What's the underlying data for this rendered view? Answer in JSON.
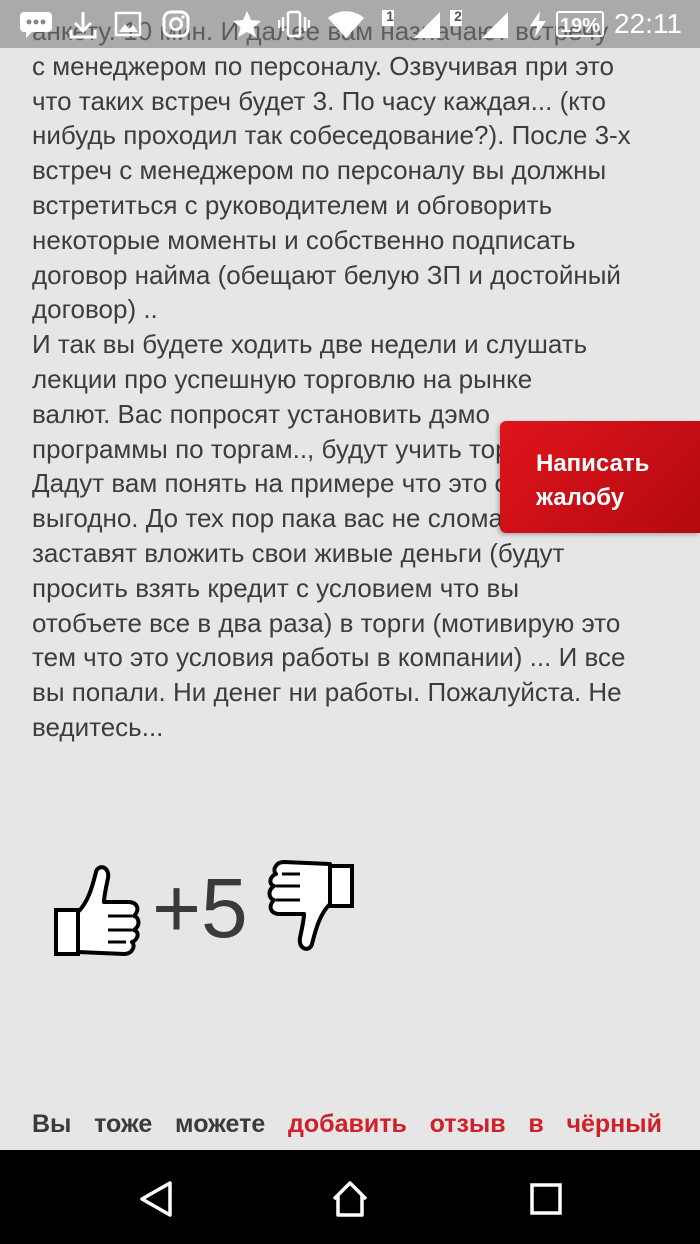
{
  "status_bar": {
    "time": "22:11",
    "battery": "19%",
    "sim1": "1",
    "sim2": "2",
    "icons": [
      "message-icon",
      "download-icon",
      "image-icon",
      "instagram-icon",
      "star-icon",
      "vibrate-icon",
      "wifi-icon",
      "signal-1-icon",
      "signal-2-icon",
      "charging-icon",
      "battery-icon"
    ]
  },
  "review": {
    "text": "анкету. 10 мин. И далее вам назначают встречу\nс менеджером по персоналу. Озвучивая при это\nчто таких встреч будет 3. По часу каждая... (кто\nнибудь проходил так собеседование?). После 3-х\nвстреч с менеджером по персоналу вы должны\nвстретиться с руководителем и обговорить\nнекоторые моменты и собственно подписать\nдоговор найма (обещают белую ЗП и достойный\nдоговор) ..\nИ так вы будете ходить две недели и слушать\nлекции про успешную торговлю на рынке\nвалют. Вас попросят установить дэмо\nпрограммы по торгам.., будут учить торговать.\nДадут вам понять на примере что это очень\nвыгодно. До тех пор пака вас не сломают и не\nзаставят вложить свои живые деньги (будут\nпросить взять кредит с условием что вы\nотобъете все в два раза) в торги (мотивирую это\nтем что это условия работы в компании) ... И все\nвы попали. Ни денег ни работы. Пожалуйста. Не\nведитесь..."
  },
  "votes": {
    "score": "+5"
  },
  "complaint_button": {
    "line1": "Написать",
    "line2": "жалобу"
  },
  "footer": {
    "w1": "Вы",
    "w2": "тоже",
    "w3": "можете",
    "link1": "добавить",
    "link2": "отзыв",
    "link3": "в",
    "link4": "чёрный"
  },
  "nav": {
    "icons": [
      "back-icon",
      "home-icon",
      "recents-icon"
    ]
  }
}
